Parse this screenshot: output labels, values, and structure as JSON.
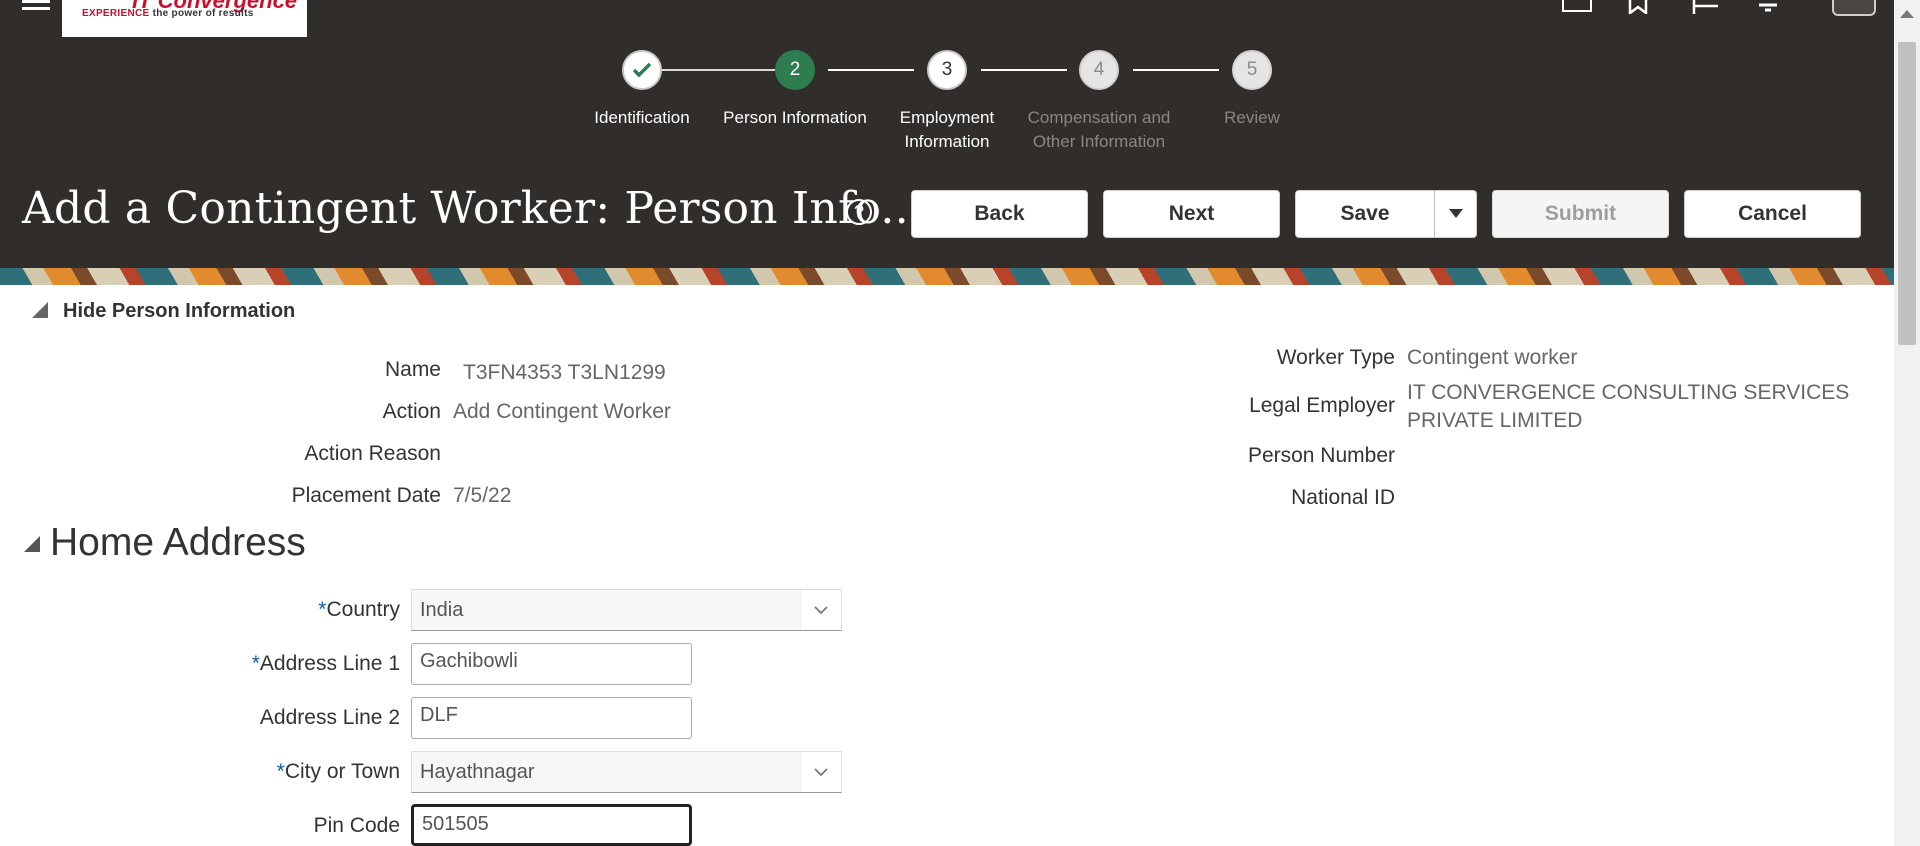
{
  "header": {
    "logo": {
      "brand": "IT Convergence",
      "tagline_prefix": "EXPERIENCE",
      "tagline_rest": "the power of results"
    },
    "page_title": "Add a Contingent Worker: Person Info...",
    "help_symbol": "?",
    "buttons": {
      "back": "Back",
      "next": "Next",
      "save": "Save",
      "submit": "Submit",
      "cancel": "Cancel"
    }
  },
  "train": {
    "steps": [
      {
        "number": "✓",
        "label": "Identification",
        "state": "done"
      },
      {
        "number": "2",
        "label": "Person Information",
        "state": "current"
      },
      {
        "number": "3",
        "label": "Employment Information",
        "state": "next"
      },
      {
        "number": "4",
        "label": "Compensation and Other Information",
        "state": "disabled"
      },
      {
        "number": "5",
        "label": "Review",
        "state": "disabled"
      }
    ]
  },
  "person_info": {
    "section_title": "Hide Person Information",
    "name_label": "Name",
    "name_value": "T3FN4353 T3LN1299",
    "action_label": "Action",
    "action_value": "Add Contingent Worker",
    "action_reason_label": "Action Reason",
    "placement_date_label": "Placement Date",
    "placement_date_value": "7/5/22",
    "worker_type_label": "Worker Type",
    "worker_type_value": "Contingent worker",
    "legal_employer_label": "Legal Employer",
    "legal_employer_value_line1": "IT CONVERGENCE CONSULTING SERVICES",
    "legal_employer_value_line2": "PRIVATE LIMITED",
    "person_number_label": "Person Number",
    "national_id_label": "National ID"
  },
  "home_address": {
    "title": "Home Address",
    "required_marker": "*",
    "country_label": "Country",
    "country_value": "India",
    "address1_label": "Address Line 1",
    "address1_value": "Gachibowli",
    "address2_label": "Address Line 2",
    "address2_value": "DLF",
    "city_label": "City or Town",
    "city_value": "Hayathnagar",
    "pin_label": "Pin Code",
    "pin_value": "501505"
  },
  "colors": {
    "header_bg": "#312d2a",
    "current_step": "#2d7d4f",
    "required": "#0b5fa5"
  },
  "icons": [
    "hamburger-icon",
    "home-icon",
    "favorites-icon",
    "flag-icon",
    "notifications-icon",
    "help-icon",
    "checkmark-icon",
    "chevron-down-icon"
  ]
}
